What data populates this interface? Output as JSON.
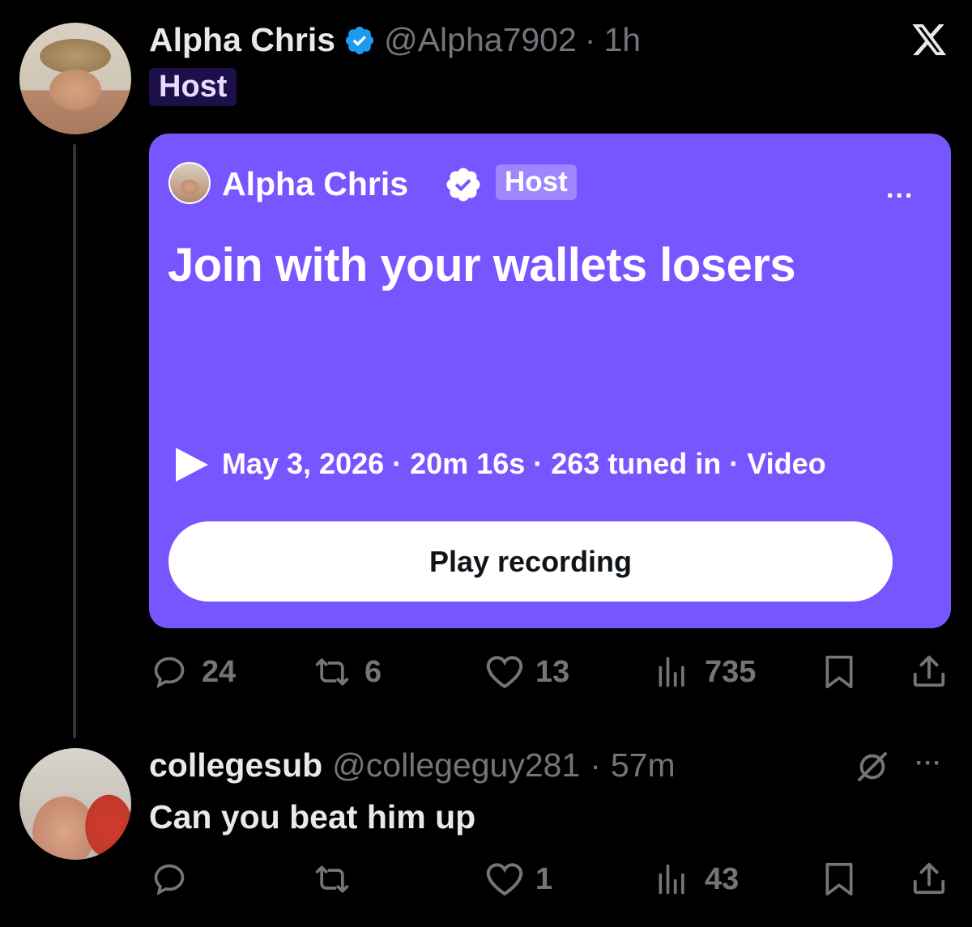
{
  "post": {
    "author_name": "Alpha Chris",
    "handle": "@Alpha7902",
    "separator": "·",
    "time": "1h",
    "host_label": "Host",
    "close_icon": "x-logo-icon"
  },
  "space_card": {
    "host_name": "Alpha Chris",
    "host_label": "Host",
    "more_label": "...",
    "title": "Join with your wallets losers",
    "meta": "May 3, 2026 · 20m 16s · 263 tuned in · Video",
    "play_button_label": "Play recording",
    "background_color": "#7856ff"
  },
  "post_actions": {
    "replies": "24",
    "reposts": "6",
    "likes": "13",
    "views": "735"
  },
  "reply": {
    "author_name": "collegesub",
    "handle": "@collegeguy281",
    "separator": "·",
    "time": "57m",
    "text": "Can you beat him up",
    "more_label": "···"
  },
  "reply_actions": {
    "replies": "",
    "reposts": "",
    "likes": "1",
    "views": "43"
  }
}
